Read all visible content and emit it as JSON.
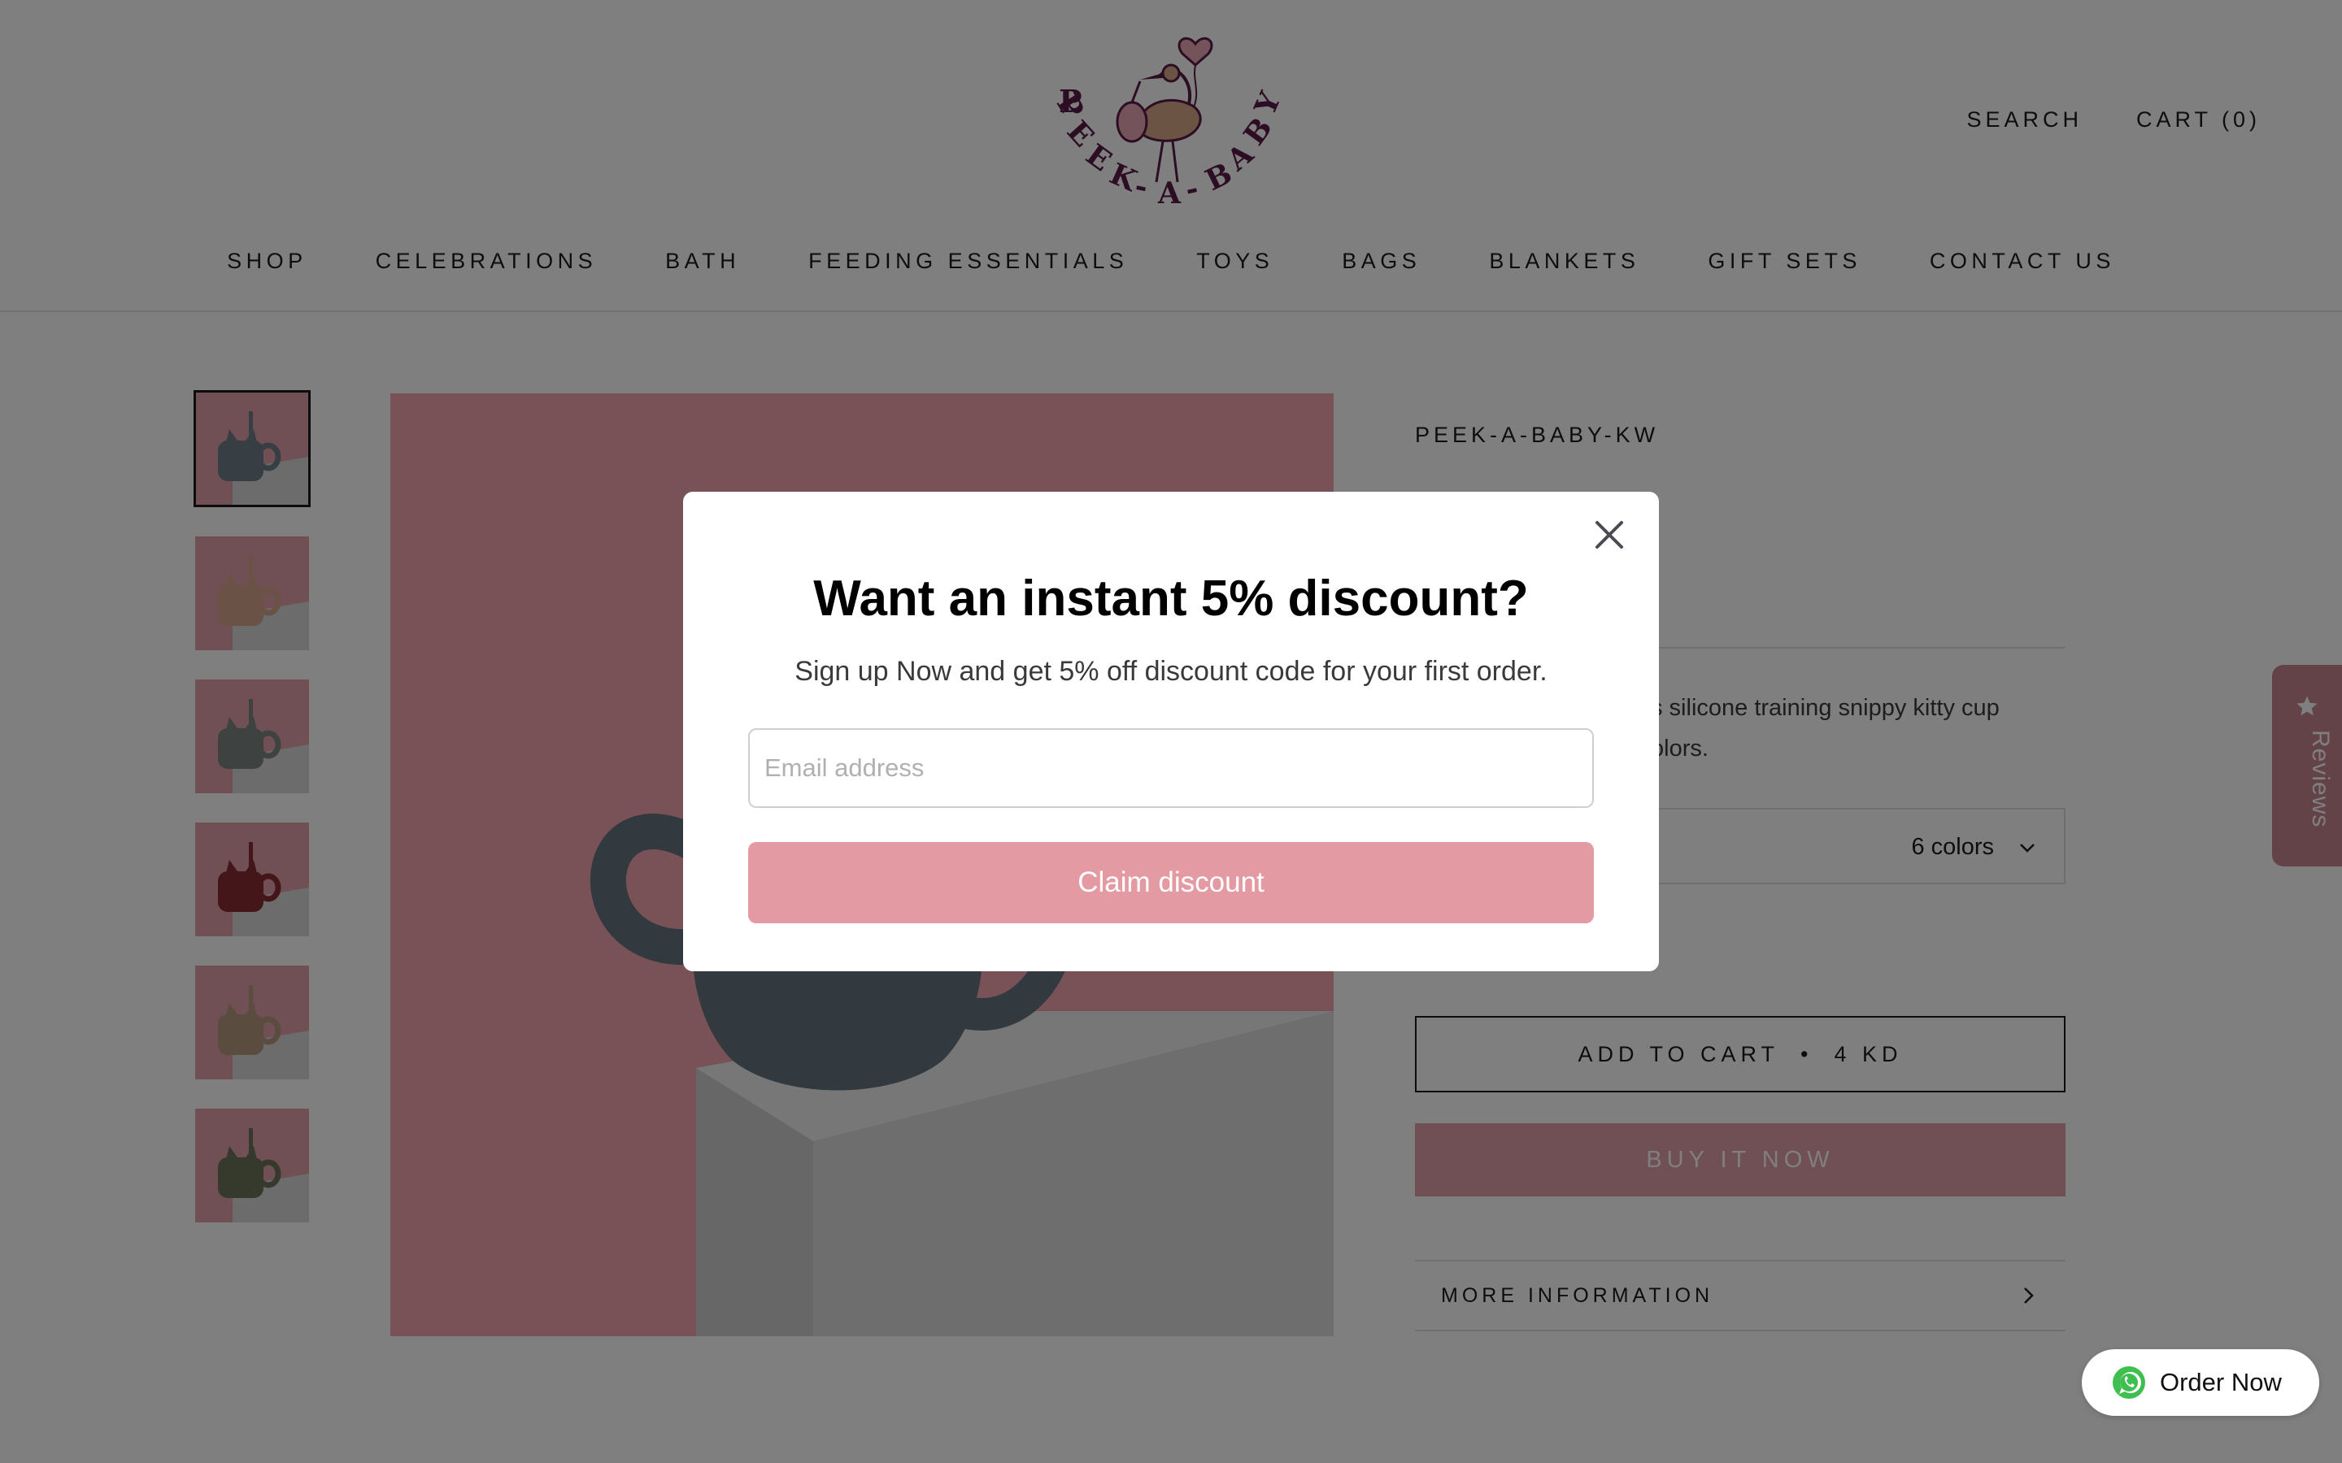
{
  "header": {
    "logo_text": "PEEK-A-BABY",
    "search_label": "SEARCH",
    "cart_label": "CART (0)"
  },
  "nav": {
    "items": [
      "SHOP",
      "CELEBRATIONS",
      "BATH",
      "FEEDING ESSENTIALS",
      "TOYS",
      "BAGS",
      "BLANKETS",
      "GIFT SETS",
      "CONTACT US"
    ]
  },
  "product": {
    "vendor": "PEEK-A-BABY-KW",
    "description_visible": "s silicone training snippy kitty cup\nolors.",
    "variant_value": "6 colors",
    "add_to_cart_label": "ADD TO CART",
    "add_to_cart_separator": "•",
    "price": "4 KD",
    "buy_now_label": "BUY IT NOW",
    "more_info_label": "MORE INFORMATION",
    "thumbnail_cup_colors": [
      "#6f7f88",
      "#d7a48f",
      "#7d8580",
      "#8a2c32",
      "#b4987c",
      "#6d7558"
    ]
  },
  "reviews_tab": {
    "label": "Reviews"
  },
  "whatsapp": {
    "label": "Order Now"
  },
  "popup": {
    "title": "Want an instant 5% discount?",
    "subtitle": "Sign up Now and get 5% off discount code for your first order.",
    "email_placeholder": "Email address",
    "claim_label": "Claim discount"
  },
  "colors": {
    "brand_pink": "#e39aa3",
    "overlay": "rgba(0,0,0,0.5)",
    "logo_purple": "#5b1a46"
  }
}
